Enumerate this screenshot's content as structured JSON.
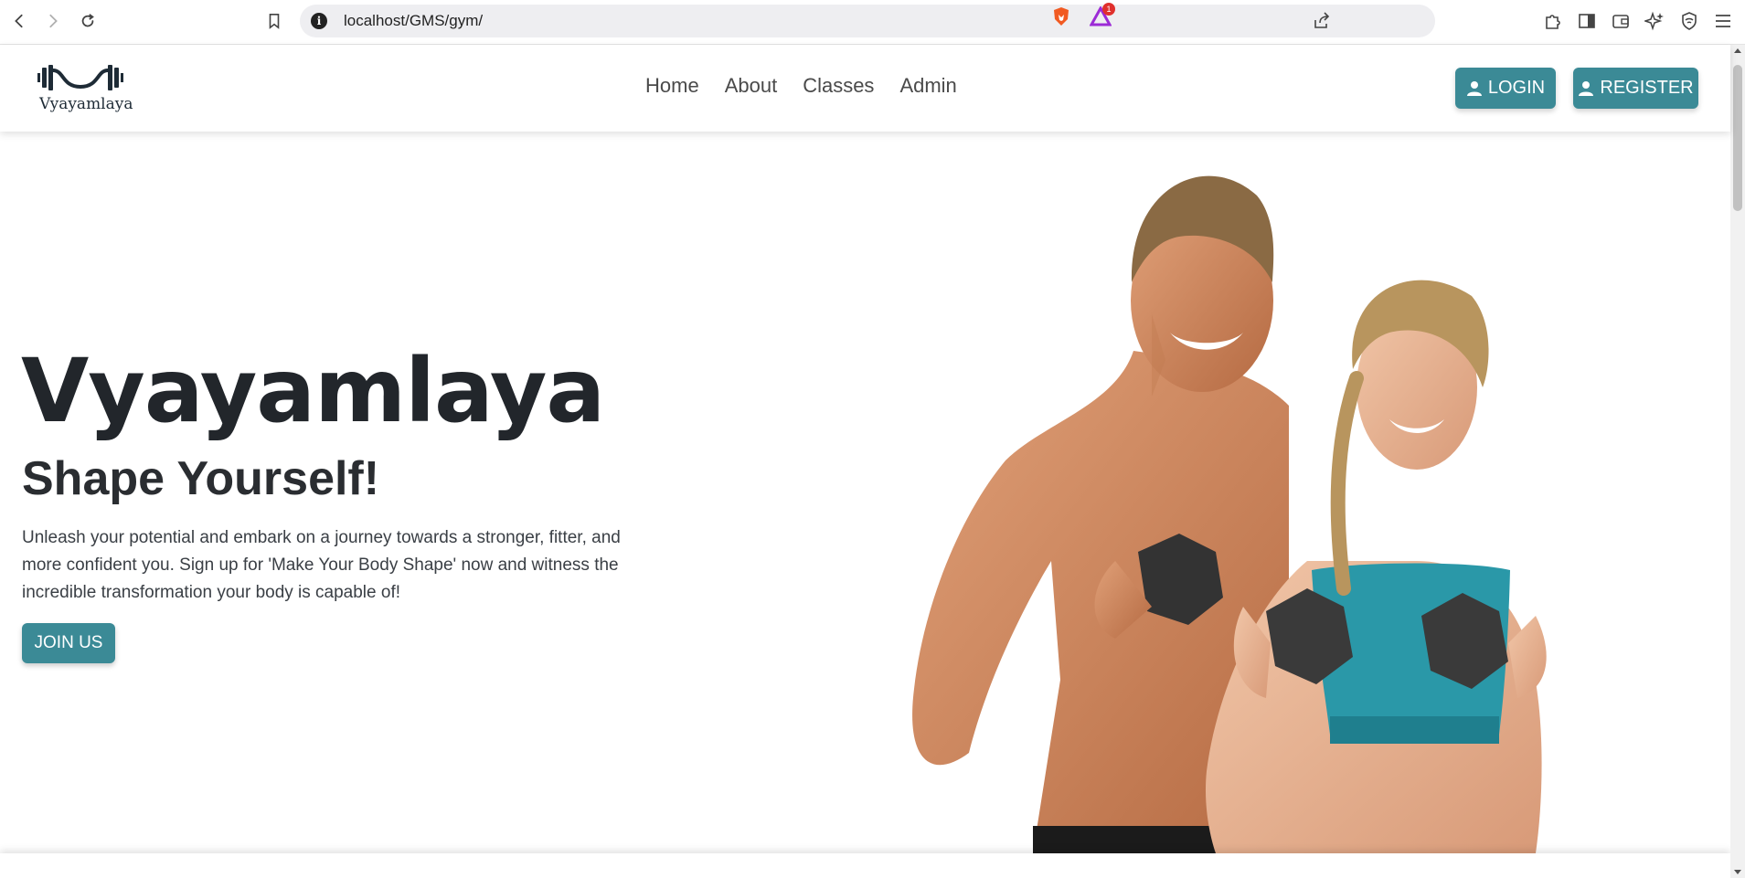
{
  "browser": {
    "url": "localhost/GMS/gym/",
    "rewards_count": "1"
  },
  "header": {
    "logo_text": "Vyayamlaya",
    "nav": [
      "Home",
      "About",
      "Classes",
      "Admin"
    ],
    "login_label": "LOGIN",
    "register_label": "REGISTER"
  },
  "hero": {
    "title": "Vyayamlaya",
    "subtitle": "Shape Yourself!",
    "body": "Unleash your potential and embark on a journey towards a stronger, fitter, and more confident you. Sign up for 'Make Your Body Shape' now and witness the incredible transformation your body is capable of!",
    "cta_label": "JOIN US"
  },
  "colors": {
    "accent": "#3b8a96",
    "heading": "#22262b"
  },
  "icons": {
    "back": "back-arrow-icon",
    "forward": "forward-arrow-icon",
    "reload": "reload-icon",
    "bookmark": "bookmark-icon",
    "site_info": "info-icon",
    "share": "share-icon",
    "shield": "brave-shield-icon",
    "rewards": "brave-rewards-icon",
    "extensions": "puzzle-icon",
    "sidebar": "sidebar-icon",
    "wallet": "wallet-icon",
    "leo": "sparkle-icon",
    "vpn": "vpn-shield-icon",
    "menu": "hamburger-menu-icon",
    "user": "user-icon"
  }
}
